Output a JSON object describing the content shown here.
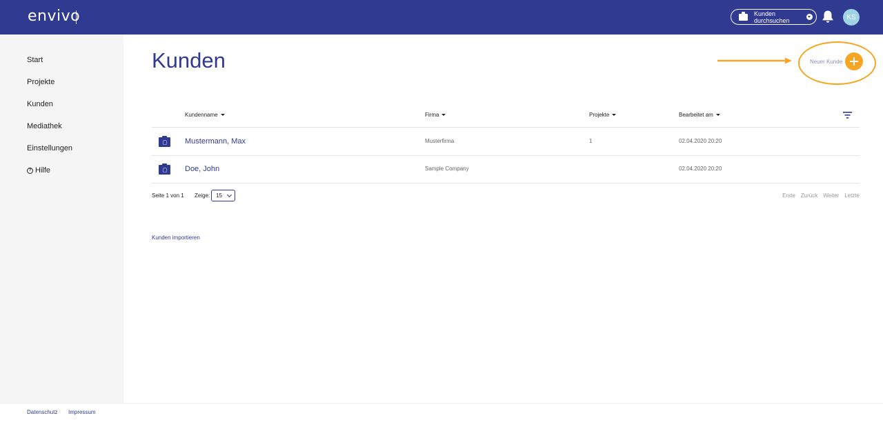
{
  "header": {
    "logo": "envivo",
    "search": {
      "label": "Kunden durchsuchen",
      "icon": "folder-icon"
    },
    "notifications": {
      "icon": "bell-icon"
    },
    "avatar": {
      "initials": "KS",
      "color": "#9fd3e6"
    },
    "background": "#313a91"
  },
  "sidebar": {
    "items": [
      {
        "label": "Start"
      },
      {
        "label": "Projekte"
      },
      {
        "label": "Kunden"
      },
      {
        "label": "Mediathek"
      },
      {
        "label": "Einstellungen"
      },
      {
        "label": "Hilfe",
        "icon": "help-circle-icon"
      }
    ]
  },
  "main": {
    "title": "Kunden",
    "new_customer": {
      "label": "Neuer Kunde",
      "icon": "plus-icon",
      "color": "#f6a623"
    },
    "table": {
      "columns": [
        {
          "label": "Kundenname"
        },
        {
          "label": "Firma"
        },
        {
          "label": "Projekte"
        },
        {
          "label": "Bearbeitet am"
        }
      ],
      "rows": [
        {
          "name": "Mustermann, Max",
          "company": "Musterfirma",
          "projects": "1",
          "edited": "02.04.2020 20:20"
        },
        {
          "name": "Doe, John",
          "company": "Sample Company",
          "projects": "",
          "edited": "02.04.2020 20:20"
        }
      ]
    },
    "pagination": {
      "info": "Seite 1 von 1",
      "show_label": "Zeige:",
      "page_size": "15",
      "links": [
        "Erste",
        "Zurück",
        "Weiter",
        "Letzte"
      ]
    },
    "import_link": "Kunden importieren"
  },
  "footer": {
    "links": [
      "Datenschutz",
      "Impressum"
    ]
  },
  "annotation": {
    "color": "#f6a623"
  }
}
